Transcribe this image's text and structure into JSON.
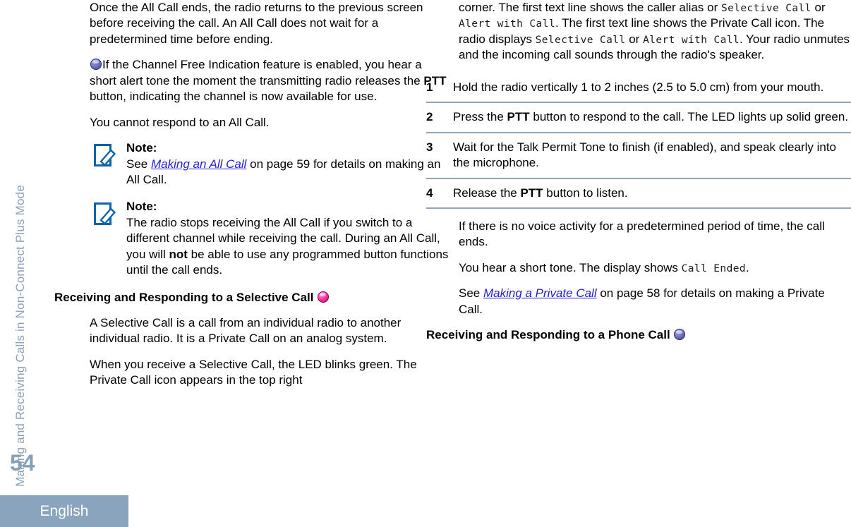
{
  "page": {
    "number": "54",
    "language_tab": "English",
    "chapter_label": "Making and Receiving Calls in Non-Connect Plus Mode",
    "colors": {
      "accent_blue_gray": "#8aa4bd",
      "xref_link": "#2222dd",
      "rule": "#8fa5bd",
      "badge_purple": "#6f6fc0",
      "badge_pink": "#f0339c"
    }
  },
  "left_column": {
    "paragraph_1": "Once the All Call ends, the radio returns to the previous screen before receiving the call. An All Call does not wait for a predetermined time before ending.",
    "paragraph_2_pre": "If the Channel Free Indication feature is enabled, you hear a short alert tone the moment the transmitting radio releases the ",
    "paragraph_2_bold": "PTT",
    "paragraph_2_post": " button, indicating the channel is now available for use.",
    "paragraph_3": "You cannot respond to an All Call.",
    "note_1": {
      "title": "Note:",
      "text_before": "See ",
      "xref": "Making an All Call",
      "text_after": " on page 59 for details on making an All Call."
    },
    "note_2": {
      "title": "Note:",
      "text_before": "The radio stops receiving the All Call if you switch to a different channel while receiving the call. During an All Call, you will ",
      "emphasis": "not",
      "text_after": " be able to use any programmed button functions until the call ends."
    },
    "section_heading": "Receiving and Responding to a Selective Call",
    "paragraph_4": "A Selective Call is a call from an individual radio to another individual radio. It is a Private Call on an analog system.",
    "paragraph_5": "When you receive a Selective Call, the LED blinks green. The Private Call icon appears in the top right"
  },
  "right_column": {
    "paragraph_1_a": "corner. The first text line shows the caller alias or ",
    "paragraph_1_disp1": "Selective Call",
    "paragraph_1_b": " or ",
    "paragraph_1_disp2": "Alert with Call",
    "paragraph_1_c": ". The first text line shows the Private Call icon. The radio displays ",
    "paragraph_1_disp3": "Selective Call",
    "paragraph_1_d": " or ",
    "paragraph_1_disp4": "Alert with Call",
    "paragraph_1_e": ". Your radio unmutes and the incoming call sounds through the radio's speaker.",
    "steps": [
      {
        "number": "1",
        "text_before": "Hold the radio vertically 1 to 2 inches (2.5 to 5.0 cm) from your mouth.",
        "bold": "",
        "text_after": ""
      },
      {
        "number": "2",
        "text_before": "Press the ",
        "bold": "PTT",
        "text_after": " button to respond to the call. The LED lights up solid green."
      },
      {
        "number": "3",
        "text_before": "Wait for the Talk Permit Tone to finish (if enabled), and speak clearly into the microphone.",
        "bold": "",
        "text_after": ""
      },
      {
        "number": "4",
        "text_before": "Release the ",
        "bold": "PTT",
        "text_after": " button to listen."
      }
    ],
    "paragraph_2": "If there is no voice activity for a predetermined period of time, the call ends.",
    "paragraph_3_before": "You hear a short tone. The display shows ",
    "paragraph_3_disp": "Call Ended",
    "paragraph_3_after": ".",
    "paragraph_4_before": "See ",
    "paragraph_4_xref": "Making a Private Call",
    "paragraph_4_after": " on page 58 for details on making a Private Call.",
    "section_heading": "Receiving and Responding to a Phone Call"
  },
  "icons": {
    "channel_free_badge": "purple-circle-badge-icon",
    "selective_call_badge": "pink-circle-badge-icon",
    "phone_call_badge": "purple-circle-badge-icon",
    "note_icon": "note-pencil-icon"
  }
}
